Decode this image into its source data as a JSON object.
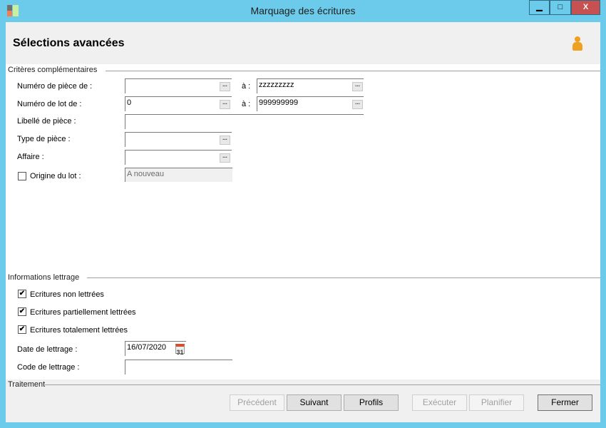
{
  "window": {
    "title": "Marquage des écritures",
    "minimize": "▁",
    "maximize": "□",
    "close": "X"
  },
  "header": {
    "title": "Sélections avancées",
    "icon": "user-icon"
  },
  "criteria": {
    "section": "Critères complémentaires",
    "to_label": "à :",
    "piece_from_label": "Numéro de pièce de :",
    "piece_from": "",
    "piece_to": "zzzzzzzzz",
    "lot_from_label": "Numéro de lot de :",
    "lot_from": "0",
    "lot_to": "999999999",
    "libelle_label": "Libellé de pièce :",
    "libelle": "",
    "type_label": "Type de pièce :",
    "type": "",
    "affaire_label": "Affaire :",
    "affaire": "",
    "origine_label": "Origine du lot :",
    "origine_checked": false,
    "origine": "A nouveau",
    "ellipsis": "..."
  },
  "lettrage": {
    "section": "Informations lettrage",
    "checkboxes": [
      {
        "label": "Ecritures non lettrées",
        "checked": true
      },
      {
        "label": "Ecritures partiellement lettrées",
        "checked": true
      },
      {
        "label": "Ecritures totalement lettrées",
        "checked": true
      }
    ],
    "check_mark": "✔",
    "date_label": "Date de lettrage :",
    "date": "16/07/2020",
    "calendar_day": "31",
    "code_label": "Code de lettrage :",
    "code": ""
  },
  "footer": {
    "section": "Traitement",
    "buttons": {
      "previous": "Précédent",
      "next": "Suivant",
      "profiles": "Profils",
      "execute": "Exécuter",
      "schedule": "Planifier",
      "close": "Fermer"
    }
  }
}
